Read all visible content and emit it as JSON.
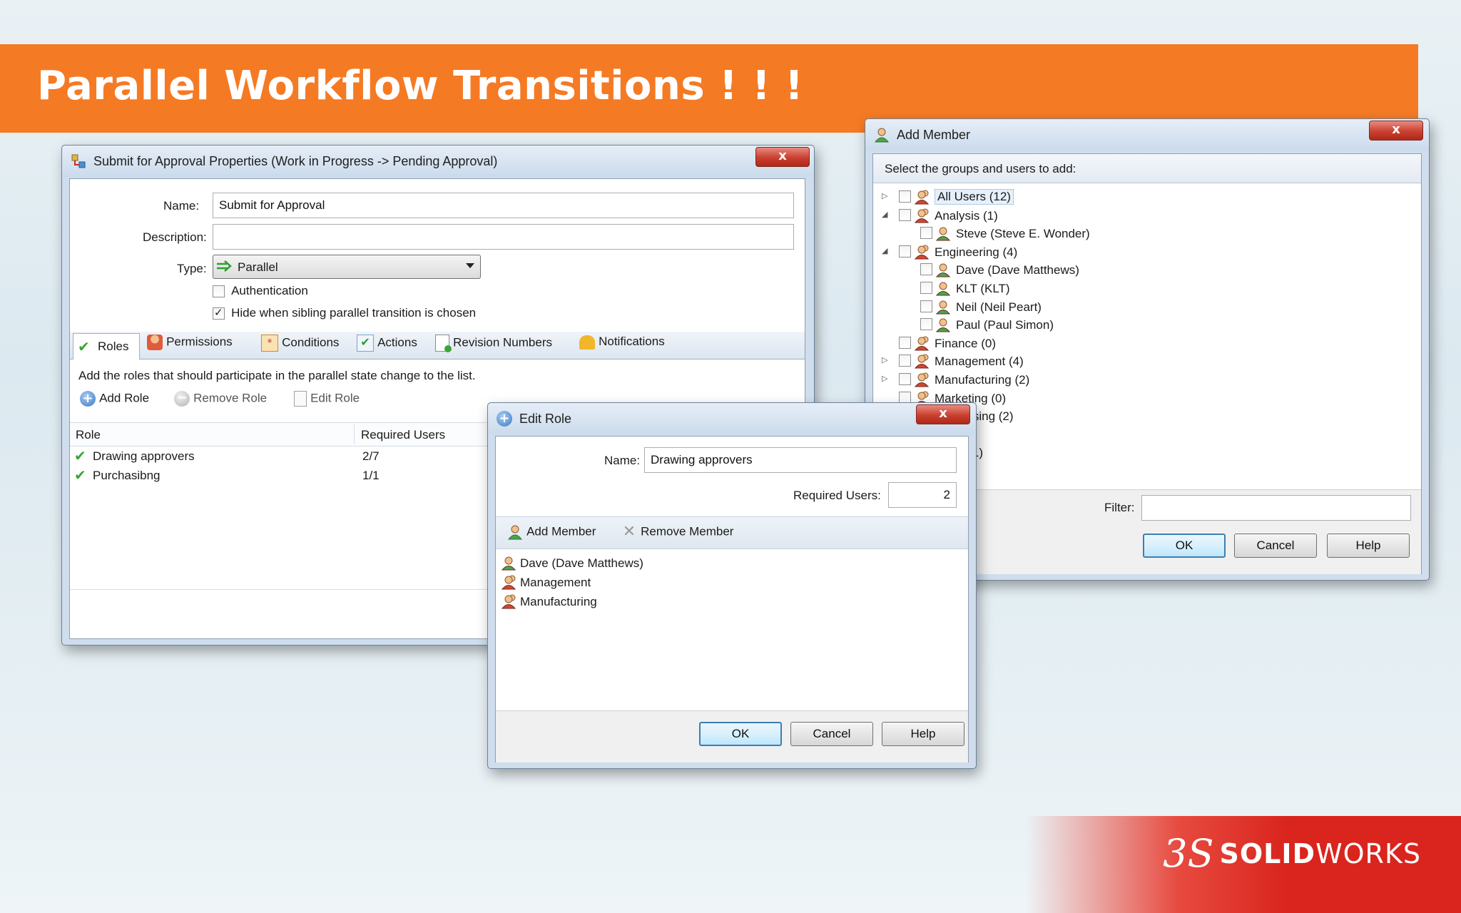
{
  "banner": {
    "title": "Parallel Workflow Transitions ! ! !"
  },
  "brand": {
    "mark": "3S",
    "name_bold": "SOLID",
    "name_light": "WORKS"
  },
  "props": {
    "title": "Submit for Approval Properties (Work in Progress -> Pending Approval)",
    "close": "x",
    "name_label": "Name:",
    "name_value": "Submit for Approval",
    "desc_label": "Description:",
    "desc_value": "",
    "type_label": "Type:",
    "type_value": "Parallel",
    "auth_label": "Authentication",
    "hide_label": "Hide when sibling parallel transition is chosen",
    "tabs": [
      "Roles",
      "Permissions",
      "Conditions",
      "Actions",
      "Revision Numbers",
      "Notifications"
    ],
    "instructions": "Add the roles that should participate in the parallel state change to the list.",
    "add_role": "Add Role",
    "remove_role": "Remove Role",
    "edit_role": "Edit Role",
    "col_role": "Role",
    "col_required": "Required Users",
    "rows": [
      {
        "role": "Drawing approvers",
        "required": "2/7"
      },
      {
        "role": "Purchasibng",
        "required": "1/1"
      }
    ]
  },
  "add_member": {
    "title": "Add Member",
    "close": "x",
    "prompt": "Select the groups and users to add:",
    "tree": [
      {
        "label": "All Users (12)",
        "expander": "▷",
        "type": "group",
        "depth": 0
      },
      {
        "label": "Analysis (1)",
        "expander": "◢",
        "type": "group",
        "depth": 0
      },
      {
        "label": "Steve (Steve E. Wonder)",
        "expander": "",
        "type": "user",
        "depth": 1
      },
      {
        "label": "Engineering (4)",
        "expander": "◢",
        "type": "group",
        "depth": 0
      },
      {
        "label": "Dave (Dave Matthews)",
        "expander": "",
        "type": "user",
        "depth": 1
      },
      {
        "label": "KLT (KLT)",
        "expander": "",
        "type": "user",
        "depth": 1
      },
      {
        "label": "Neil (Neil Peart)",
        "expander": "",
        "type": "user",
        "depth": 1
      },
      {
        "label": "Paul (Paul Simon)",
        "expander": "",
        "type": "user",
        "depth": 1
      },
      {
        "label": "Finance (0)",
        "expander": "",
        "type": "group",
        "depth": 0
      },
      {
        "label": "Management (4)",
        "expander": "▷",
        "type": "group",
        "depth": 0
      },
      {
        "label": "Manufacturing (2)",
        "expander": "▷",
        "type": "group",
        "depth": 0
      },
      {
        "label": "Marketing (0)",
        "expander": "",
        "type": "group",
        "depth": 0
      },
      {
        "label": "Purchasing (2)",
        "expander": "",
        "type": "group",
        "depth": 0
      },
      {
        "label": "",
        "expander": "",
        "type": "blank",
        "depth": 0
      },
      {
        "label": "Sales (1)",
        "expander": "",
        "type": "group",
        "depth": 0
      }
    ],
    "filter_label": "Filter:",
    "filter_value": "",
    "ok": "OK",
    "cancel": "Cancel",
    "help": "Help"
  },
  "edit_role": {
    "title": "Edit Role",
    "close": "x",
    "name_label": "Name:",
    "name_value": "Drawing approvers",
    "required_label": "Required Users:",
    "required_value": "2",
    "add_member": "Add Member",
    "remove_member": "Remove Member",
    "members": [
      {
        "label": "Dave (Dave Matthews)",
        "type": "user"
      },
      {
        "label": "Management",
        "type": "group"
      },
      {
        "label": "Manufacturing",
        "type": "group"
      }
    ],
    "ok": "OK",
    "cancel": "Cancel",
    "help": "Help"
  }
}
